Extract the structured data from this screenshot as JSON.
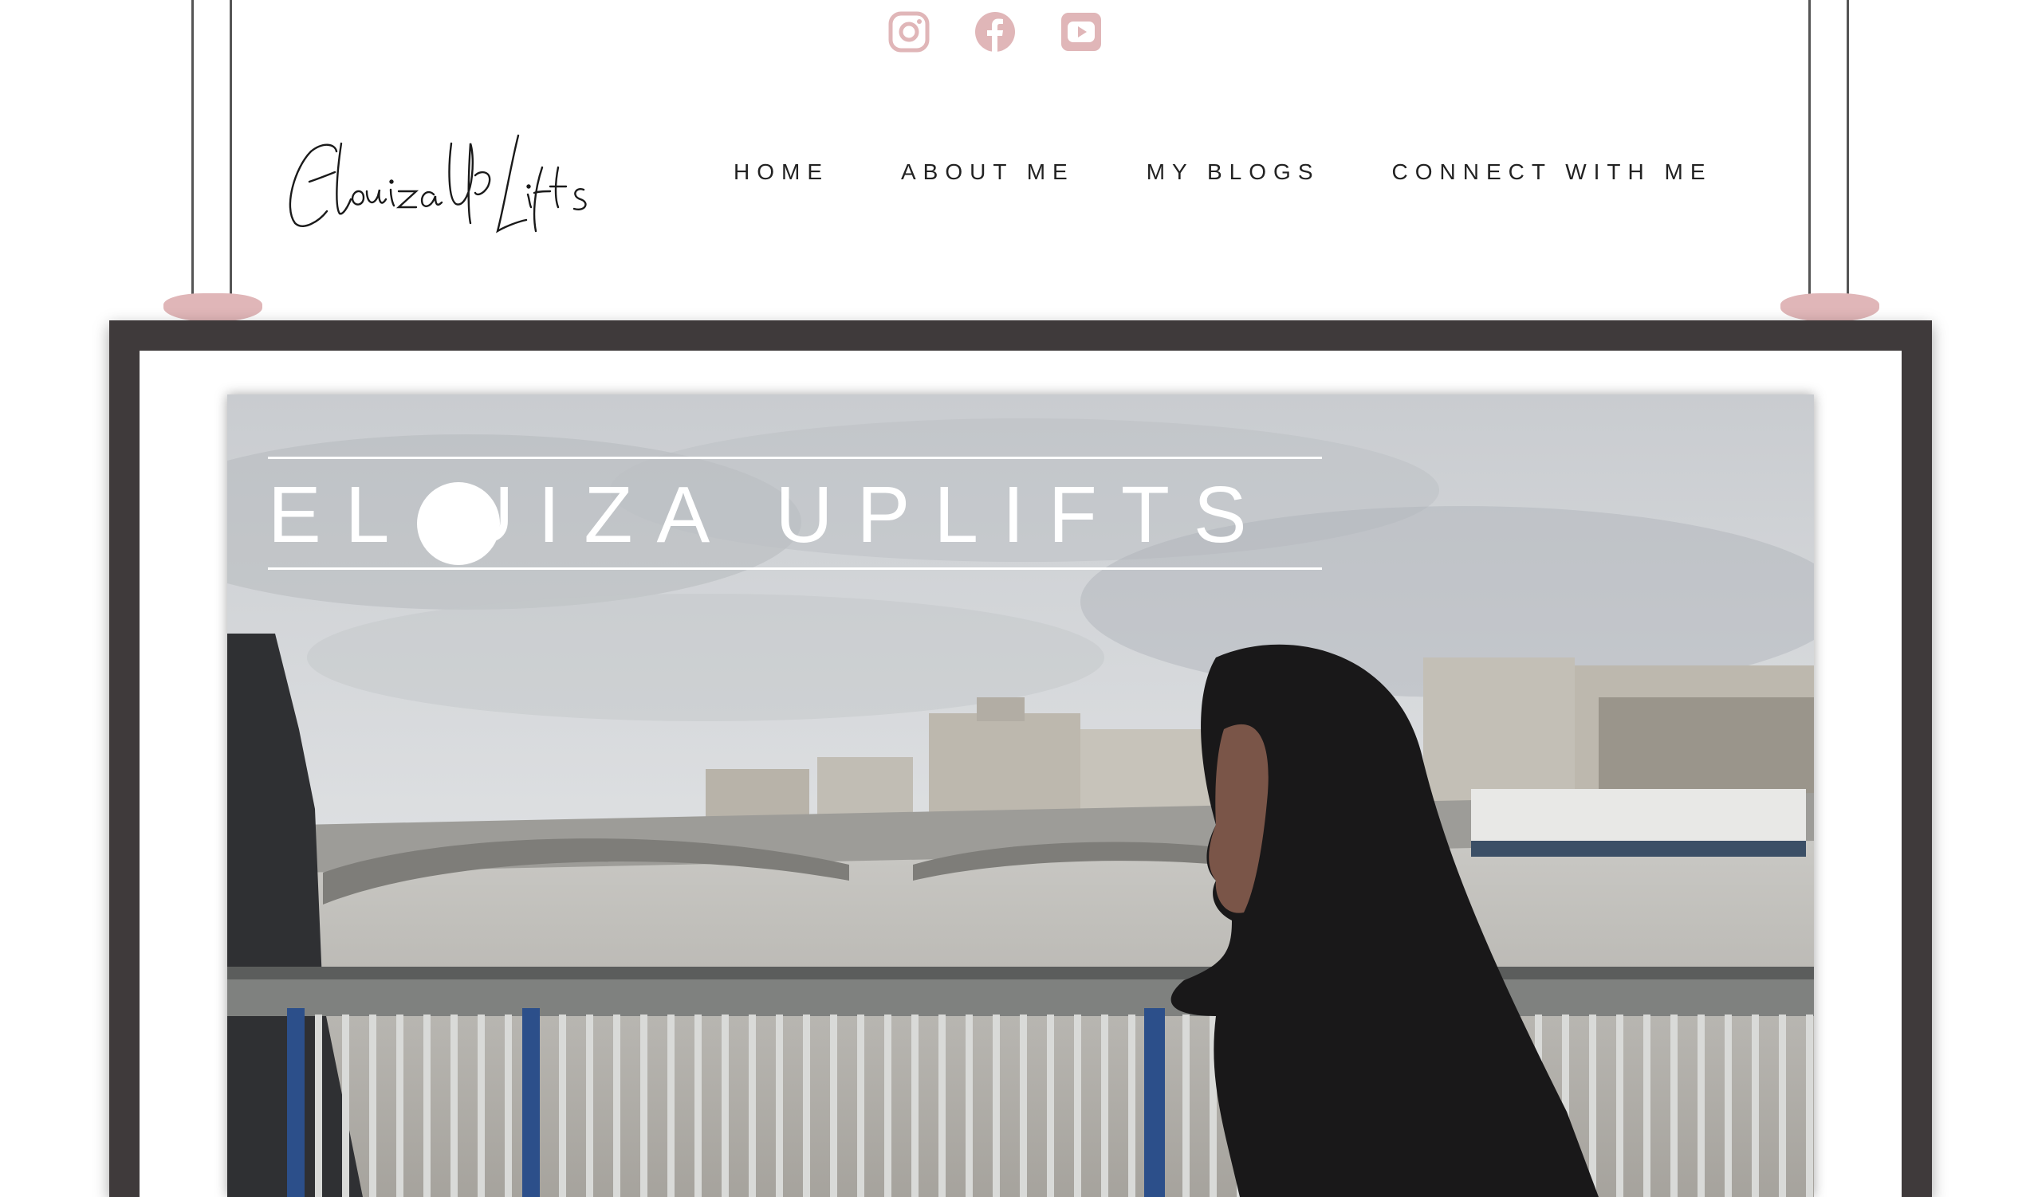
{
  "socials": [
    {
      "icon": "instagram-icon"
    },
    {
      "icon": "facebook-icon"
    },
    {
      "icon": "youtube-icon"
    }
  ],
  "brand": {
    "logo_text": "ElouizaUpLifts"
  },
  "nav": {
    "items": [
      "HOME",
      "ABOUT ME",
      "MY BLOGS",
      "CONNECT WITH ME"
    ]
  },
  "hero": {
    "title": "EL UIZA UPLIFTS"
  },
  "colors": {
    "accent_pink": "#e0b6b8",
    "frame": "#3f3a3b",
    "text": "#222222"
  }
}
